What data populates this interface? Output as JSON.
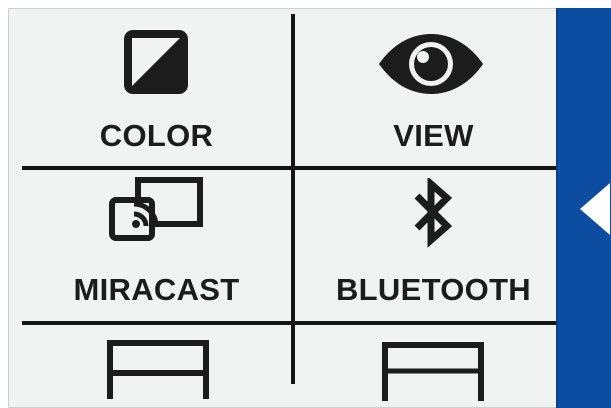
{
  "menu": {
    "items": [
      {
        "label": "COLOR",
        "icon": "contrast-icon"
      },
      {
        "label": "VIEW",
        "icon": "eye-icon"
      },
      {
        "label": "MIRACAST",
        "icon": "cast-icon"
      },
      {
        "label": "BLUETOOTH",
        "icon": "bluetooth-icon"
      },
      {
        "label": "",
        "icon": "layout-icon"
      },
      {
        "label": "",
        "icon": "layout-icon"
      }
    ]
  },
  "side_panel": {
    "icon": "arrow-left-icon",
    "color": "#0c4da2"
  },
  "colors": {
    "background": "#f1f2f2",
    "grid_lines": "#151515",
    "accent": "#0c4da2"
  }
}
